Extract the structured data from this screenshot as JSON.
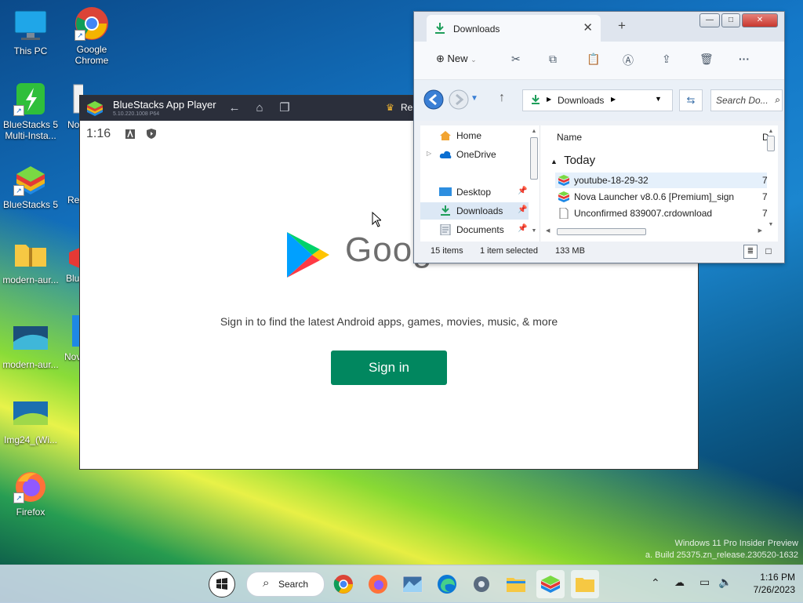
{
  "desktop": {
    "icons": [
      {
        "label": "This PC"
      },
      {
        "label": "Google Chrome"
      },
      {
        "label": "BlueStacks 5 Multi-Insta..."
      },
      {
        "label": "No"
      },
      {
        "label": "BlueStacks 5"
      },
      {
        "label": "Re"
      },
      {
        "label": "modern-aur..."
      },
      {
        "label": "Blu"
      },
      {
        "label": "modern-aur..."
      },
      {
        "label": "Nov"
      },
      {
        "label": "Img24_(Wi..."
      },
      {
        "label": "Firefox"
      }
    ]
  },
  "bluestacks": {
    "title": "BlueStacks App Player",
    "version": "5.10.220.1008 P64",
    "right_label": "Re",
    "android_time": "1:16",
    "wordmark": "Goog",
    "sign_text": "Sign in to find the latest Android apps, games, movies, music, & more",
    "sign_button": "Sign in"
  },
  "explorer": {
    "tab_title": "Downloads",
    "toolbar": {
      "new_label": "New"
    },
    "address": {
      "crumb": "Downloads"
    },
    "search_placeholder": "Search Do...",
    "nav": [
      {
        "label": "Home",
        "icon": "home-icon"
      },
      {
        "label": "OneDrive",
        "icon": "cloud-icon"
      },
      {
        "label": "Desktop",
        "icon": "desktop-folder-icon"
      },
      {
        "label": "Downloads",
        "icon": "download-icon"
      },
      {
        "label": "Documents",
        "icon": "documents-icon"
      }
    ],
    "column_name": "Name",
    "column_date": "D",
    "group_label": "Today",
    "files": [
      {
        "name": "youtube-18-29-32",
        "date": "7"
      },
      {
        "name": "Nova Launcher v8.0.6 [Premium]_sign",
        "date": "7"
      },
      {
        "name": "Unconfirmed 839007.crdownload",
        "date": "7"
      }
    ],
    "status": {
      "count": "15 items",
      "selected": "1 item selected",
      "size": "133 MB"
    }
  },
  "taskbar": {
    "search_label": "Search",
    "time": "1:16 PM",
    "date": "7/26/2023"
  },
  "watermark": {
    "line1": "Windows 11 Pro Insider Preview",
    "line2": "a. Build 25375.zn_release.230520-1632"
  },
  "colors": {
    "google_play_green": "#01875f",
    "accent": "#0067c0"
  }
}
